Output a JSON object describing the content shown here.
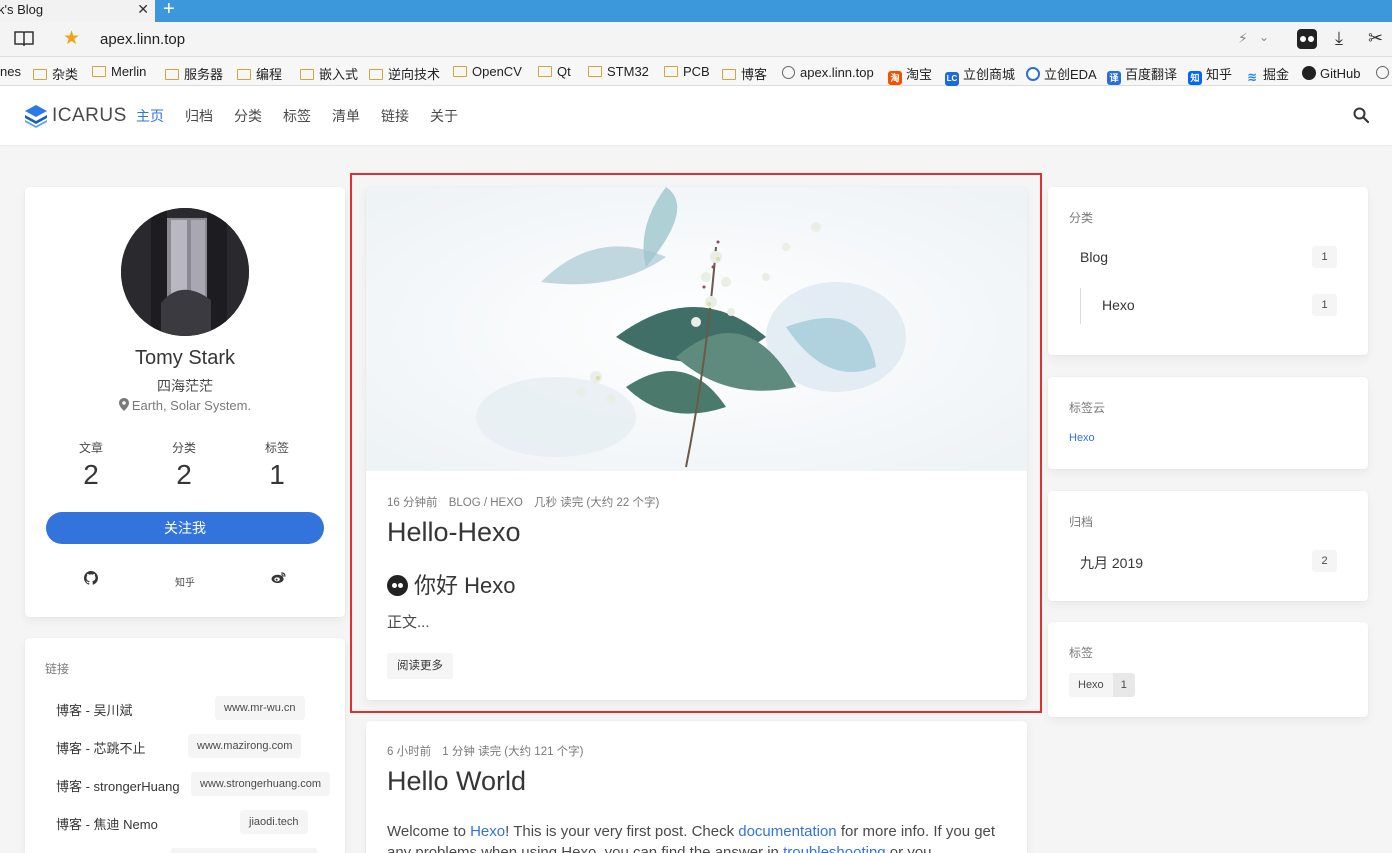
{
  "browser": {
    "tab_title": "k's Blog",
    "tab_close": "✕",
    "new_tab": "+",
    "url": "apex.linn.top",
    "bookmarks": {
      "b0": "nes",
      "b1": "杂类",
      "b2": "Merlin",
      "b3": "服务器",
      "b4": "编程",
      "b5": "嵌入式",
      "b6": "逆向技术",
      "b7": "OpenCV",
      "b8": "Qt",
      "b9": "STM32",
      "b10": "PCB",
      "b11": "博客",
      "b12": "apex.linn.top",
      "b13": "淘宝",
      "b14": "立创商城",
      "b15": "立创EDA",
      "b16": "百度翻译",
      "b17": "知乎",
      "b18": "掘金",
      "b19": "GitHub"
    },
    "bookmark_icons": {
      "taobao": "淘",
      "lc": "LC",
      "baidu": "译",
      "zhihu": "知"
    }
  },
  "navbar": {
    "logo_text": "ICARUS",
    "items": [
      "主页",
      "归档",
      "分类",
      "标签",
      "清单",
      "链接",
      "关于"
    ]
  },
  "profile": {
    "name": "Tomy Stark",
    "subtitle": "四海茫茫",
    "location": "Earth, Solar System.",
    "stats": [
      {
        "label": "文章",
        "value": "2"
      },
      {
        "label": "分类",
        "value": "2"
      },
      {
        "label": "标签",
        "value": "1"
      }
    ],
    "follow_label": "关注我",
    "social_zhihu": "知乎"
  },
  "links": {
    "title": "链接",
    "items": [
      {
        "name": "博客 - 吴川斌",
        "url": "www.mr-wu.cn"
      },
      {
        "name": "博客 - 芯跳不止",
        "url": "www.mazirong.com"
      },
      {
        "name": "博客 - strongerHuang",
        "url": "www.strongerhuang.com"
      },
      {
        "name": "博客 - 焦迪 Nemo",
        "url": "jiaodi.tech"
      }
    ]
  },
  "posts": [
    {
      "time": "16 分钟前",
      "category": "BLOG / HEXO",
      "read": "几秒 读完 (大约 22 个字)",
      "title": "Hello-Hexo",
      "heading": "你好 Hexo",
      "excerpt": "正文...",
      "read_more": "阅读更多"
    },
    {
      "time": "6 小时前",
      "read": "1 分钟 读完 (大约 121 个字)",
      "title": "Hello World",
      "text_1": "Welcome to ",
      "link_1": "Hexo",
      "text_2": "! This is your very first post. Check ",
      "link_2": "documentation",
      "text_3": " for more info. If you get any problems when using Hexo, you can find the answer in ",
      "link_3": "troubleshooting",
      "text_4": " or you"
    }
  ],
  "widgets": {
    "categories": {
      "title": "分类",
      "items": [
        {
          "name": "Blog",
          "count": "1"
        },
        {
          "name": "Hexo",
          "count": "1"
        }
      ]
    },
    "tagcloud": {
      "title": "标签云",
      "tag": "Hexo"
    },
    "archives": {
      "title": "归档",
      "items": [
        {
          "name": "九月 2019",
          "count": "2"
        }
      ]
    },
    "tags": {
      "title": "标签",
      "items": [
        {
          "name": "Hexo",
          "count": "1"
        }
      ]
    }
  },
  "colors": {
    "accent": "#3273dc",
    "highlight": "#e03131",
    "tabbar": "#3d97db"
  }
}
